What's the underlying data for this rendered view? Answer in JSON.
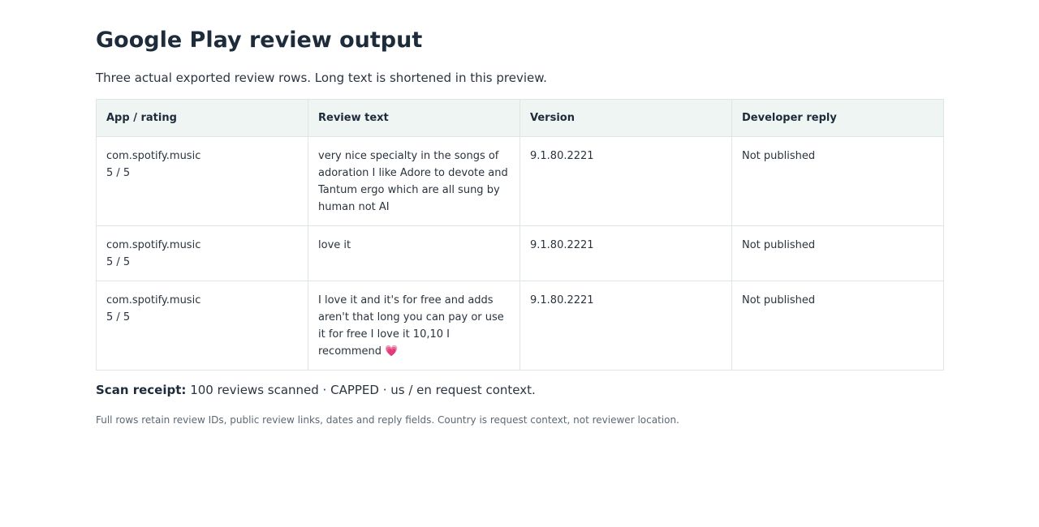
{
  "page": {
    "title": "Google Play review output",
    "subtitle": "Three actual exported review rows. Long text is shortened in this preview."
  },
  "table": {
    "headers": [
      "App / rating",
      "Review text",
      "Version",
      "Developer reply"
    ],
    "rows": [
      {
        "app": "com.spotify.music",
        "rating": "5 / 5",
        "review": "very nice specialty in the songs of adoration I like Adore to devote and Tantum ergo which are all sung by human not AI",
        "version": "9.1.80.2221",
        "reply": "Not published"
      },
      {
        "app": "com.spotify.music",
        "rating": "5 / 5",
        "review": "love it",
        "version": "9.1.80.2221",
        "reply": "Not published"
      },
      {
        "app": "com.spotify.music",
        "rating": "5 / 5",
        "review": "I love it and it's for free and adds aren't that long you can pay or use it for free I love it 10,10 I recommend 💗",
        "version": "9.1.80.2221",
        "reply": "Not published"
      }
    ]
  },
  "receipt": {
    "label": "Scan receipt:",
    "text": "100 reviews scanned · CAPPED · us / en request context."
  },
  "footnote": "Full rows retain review IDs, public review links, dates and reply fields. Country is request context, not reviewer location."
}
